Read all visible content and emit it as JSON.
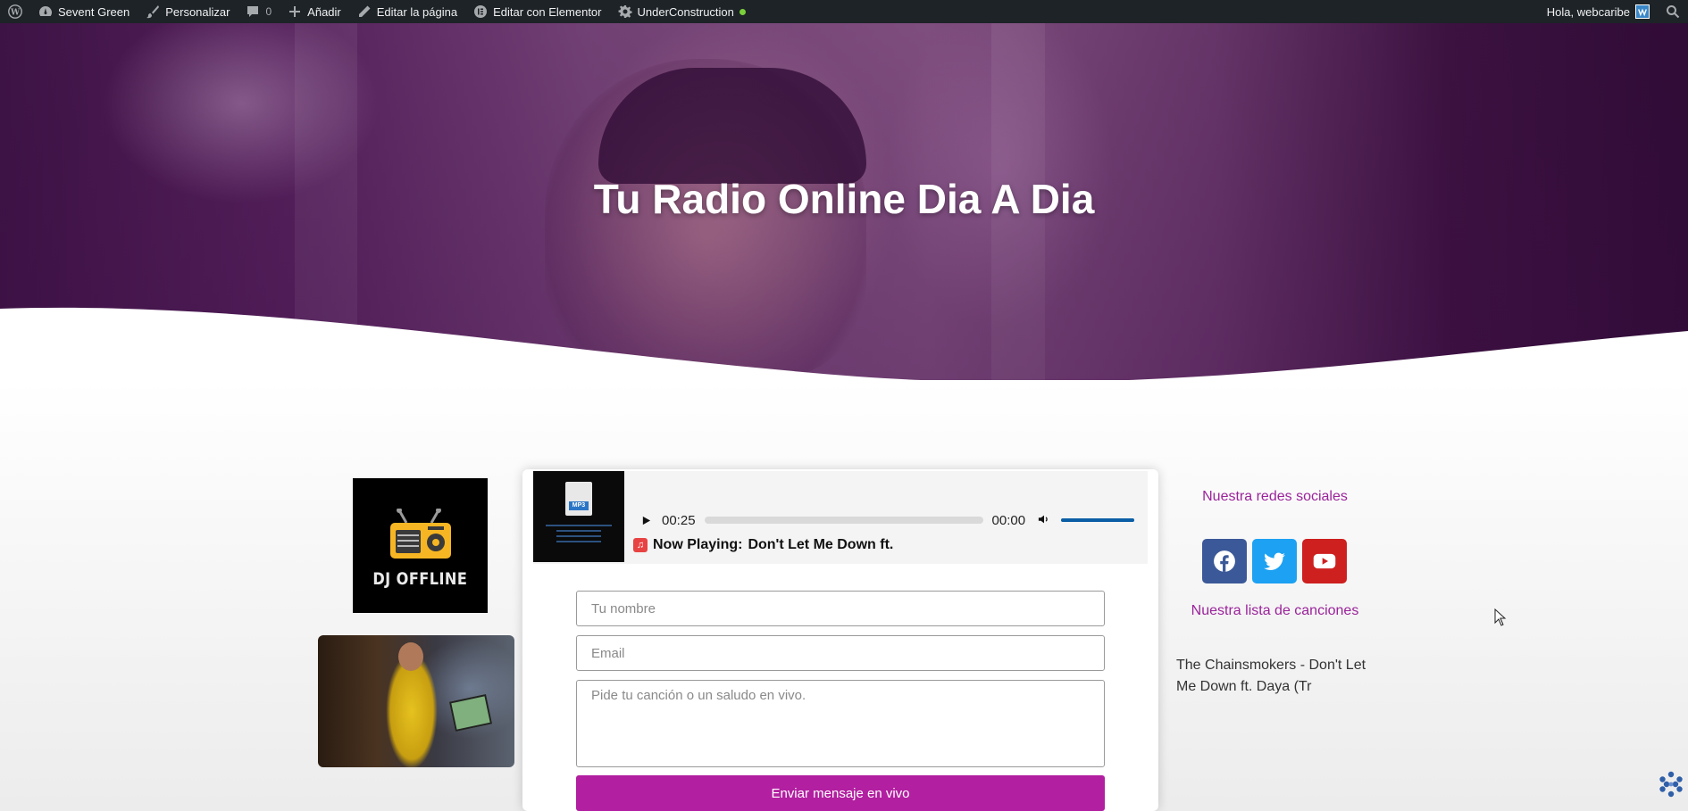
{
  "admin_bar": {
    "site_name": "Sevent Green",
    "customize": "Personalizar",
    "comments_count": "0",
    "add_new": "Añadir",
    "edit_page": "Editar la página",
    "edit_elementor": "Editar con Elementor",
    "maintenance": "UnderConstruction",
    "greeting": "Hola, webcaribe"
  },
  "hero": {
    "title": "Tu Radio Online Dia A Dia"
  },
  "left_column": {
    "dj_status": "DJ OFFLINE"
  },
  "player": {
    "art_label": "MP3",
    "current_time": "00:25",
    "duration": "00:00",
    "now_playing_label": "Now Playing:",
    "now_playing_track": "Don't Let Me Down ft.",
    "volume": 1.0
  },
  "form": {
    "name_placeholder": "Tu nombre",
    "email_placeholder": "Email",
    "message_placeholder": "Pide tu canción o un saludo en vivo.",
    "send_label": "Enviar mensaje en vivo"
  },
  "right_column": {
    "social_title": "Nuestra redes sociales",
    "songs_title": "Nuestra lista de canciones",
    "song_list": "The Chainsmokers - Don't Let Me Down ft. Daya (Tr"
  },
  "colors": {
    "accent": "#b21fa0",
    "link": "#9b239b",
    "admin_bar": "#1d2327",
    "facebook": "#3b5998",
    "twitter": "#1da1f2",
    "youtube": "#cd201f"
  }
}
